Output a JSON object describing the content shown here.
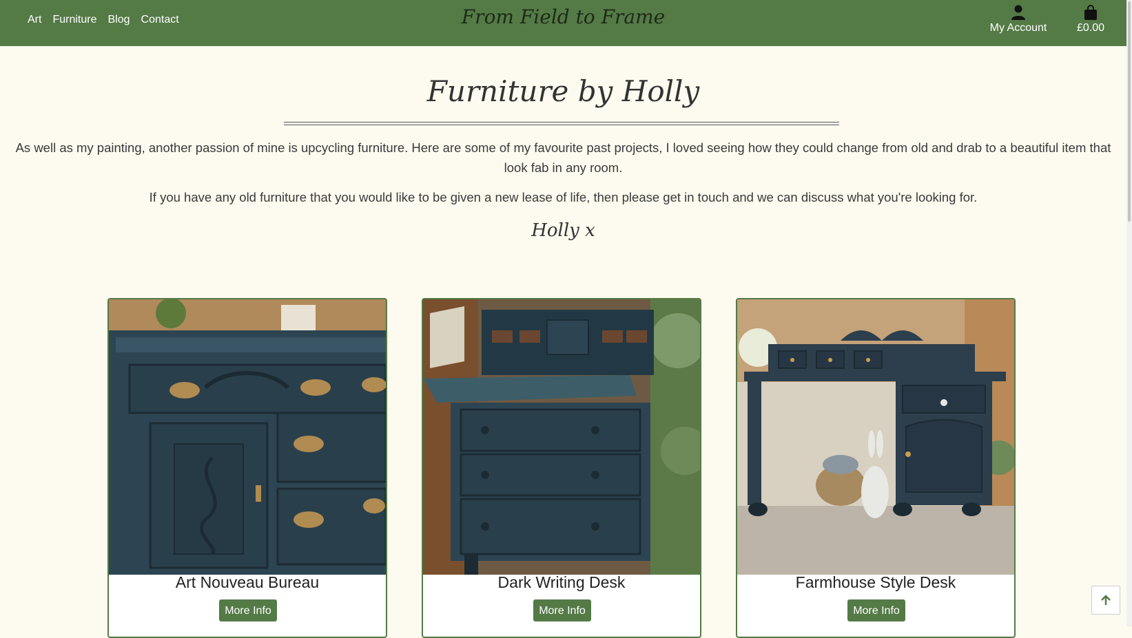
{
  "nav": {
    "links": [
      "Art",
      "Furniture",
      "Blog",
      "Contact"
    ],
    "brand": "From Field to Frame",
    "account_label": "My Account",
    "account_icon": "user-icon",
    "bag_total": "£0.00",
    "bag_icon": "shopping-bag-icon"
  },
  "main": {
    "title": "Furniture by Holly",
    "intro": "As well as my painting, another passion of mine is upcycling furniture. Here are some of my favourite past projects, I loved seeing how they could change from old and drab to a beautiful item that look fab in any room.",
    "intro2": "If you have any old furniture that you would like to be given a new lease of life, then please get in touch and we can discuss what you're looking for.",
    "signature": "Holly x"
  },
  "cards": [
    {
      "title": "Art Nouveau Bureau",
      "button": "More Info"
    },
    {
      "title": "Dark Writing Desk",
      "button": "More Info"
    },
    {
      "title": "Farmhouse Style Desk",
      "button": "More Info"
    }
  ],
  "colors": {
    "brand_green": "#547a46",
    "page_bg": "#fdfaef",
    "furniture_paint": "#2d4553"
  },
  "back_to_top_icon": "arrow-up-icon"
}
